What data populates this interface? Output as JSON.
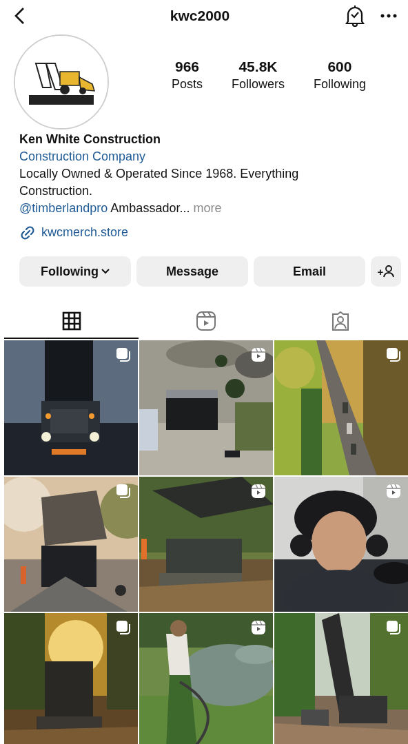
{
  "header": {
    "title": "kwc2000"
  },
  "profile": {
    "stats": [
      {
        "value": "966",
        "label": "Posts"
      },
      {
        "value": "45.8K",
        "label": "Followers"
      },
      {
        "value": "600",
        "label": "Following"
      }
    ]
  },
  "bio": {
    "name": "Ken White Construction",
    "category": "Construction Company",
    "text": "Locally Owned & Operated Since 1968. Everything Construction.",
    "mention": "@timberlandpro",
    "mention_rest": "Ambassador...",
    "more": "more",
    "link": "kwcmerch.store"
  },
  "buttons": [
    {
      "label": "Following",
      "kind": "dropdown"
    },
    {
      "label": "Message",
      "kind": "plain"
    },
    {
      "label": "Email",
      "kind": "plain"
    },
    {
      "label": "+",
      "kind": "add-person"
    }
  ],
  "tabs": [
    {
      "kind": "grid",
      "selected": true
    },
    {
      "kind": "reels",
      "selected": false
    },
    {
      "kind": "tagged",
      "selected": false
    }
  ],
  "posts": [
    {
      "kind": "carousel"
    },
    {
      "kind": "reel"
    },
    {
      "kind": "carousel"
    },
    {
      "kind": "carousel"
    },
    {
      "kind": "reel"
    },
    {
      "kind": "reel"
    },
    {
      "kind": "carousel"
    },
    {
      "kind": "reel"
    },
    {
      "kind": "carousel"
    }
  ]
}
